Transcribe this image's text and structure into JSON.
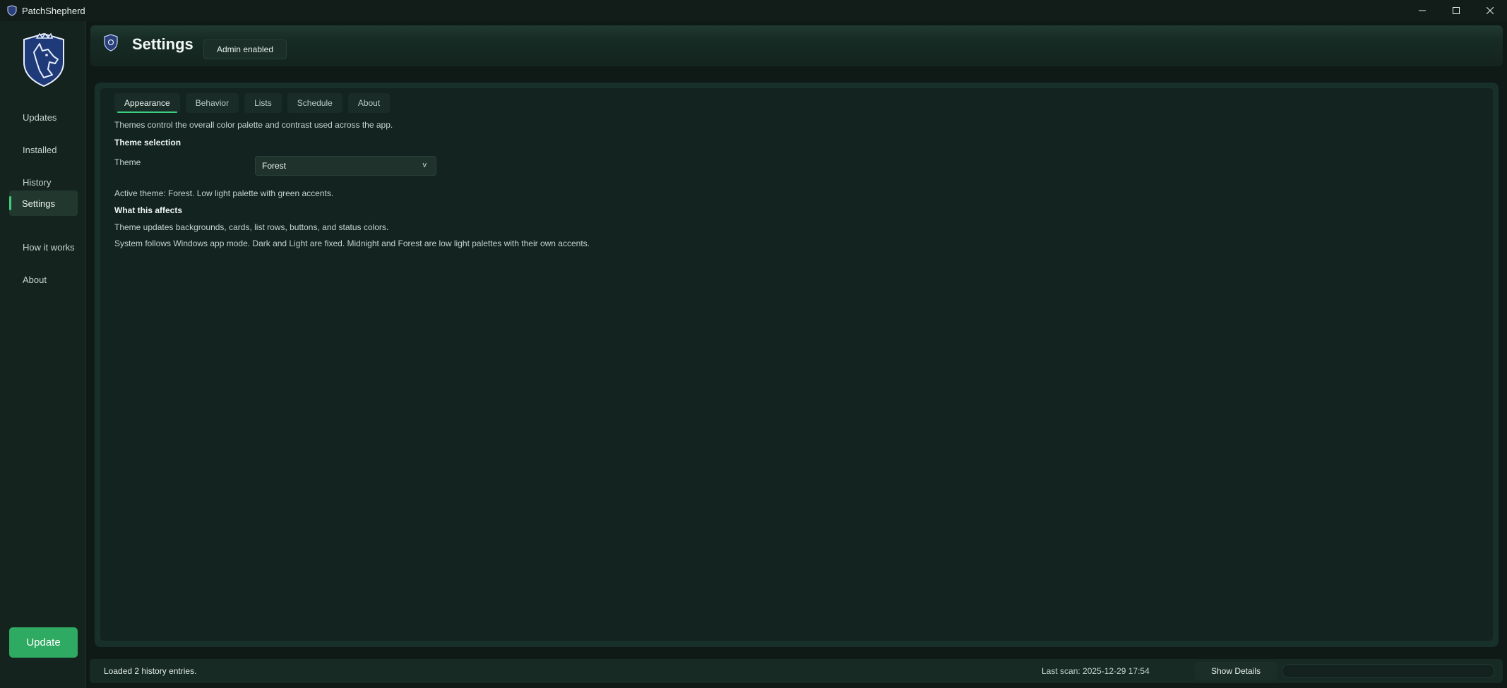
{
  "window": {
    "title": "PatchShepherd",
    "controls": {
      "minimize": "—",
      "maximize": "☐",
      "close": "✕"
    }
  },
  "sidebar": {
    "items": [
      {
        "label": "Updates",
        "active": false
      },
      {
        "label": "Installed",
        "active": false
      },
      {
        "label": "History",
        "active": false
      },
      {
        "label": "Settings",
        "active": true
      },
      {
        "label": "How it works",
        "active": false
      },
      {
        "label": "About",
        "active": false
      }
    ],
    "update_button": "Update"
  },
  "header": {
    "title": "Settings",
    "badge": "Admin enabled"
  },
  "tabs": [
    {
      "label": "Appearance",
      "active": true
    },
    {
      "label": "Behavior",
      "active": false
    },
    {
      "label": "Lists",
      "active": false
    },
    {
      "label": "Schedule",
      "active": false
    },
    {
      "label": "About",
      "active": false
    }
  ],
  "appearance": {
    "intro": "Themes control the overall color palette and contrast used across the app.",
    "section_title": "Theme selection",
    "theme_label": "Theme",
    "theme_value": "Forest",
    "theme_chevron": "v",
    "active_theme_text": "Active theme: Forest. Low light palette with green accents.",
    "affects_title": "What this affects",
    "affects_line1": "Theme updates backgrounds, cards, list rows, buttons, and status colors.",
    "affects_line2": "System follows Windows app mode. Dark and Light are fixed. Midnight and Forest are low light palettes with their own accents."
  },
  "statusbar": {
    "message": "Loaded 2 history entries.",
    "last_scan": "Last scan: 2025-12-29 17:54",
    "show_details": "Show Details",
    "progress_fraction": 0
  },
  "colors": {
    "accent": "#3ecf7e",
    "button": "#2faa63",
    "background": "#0f1a17"
  }
}
